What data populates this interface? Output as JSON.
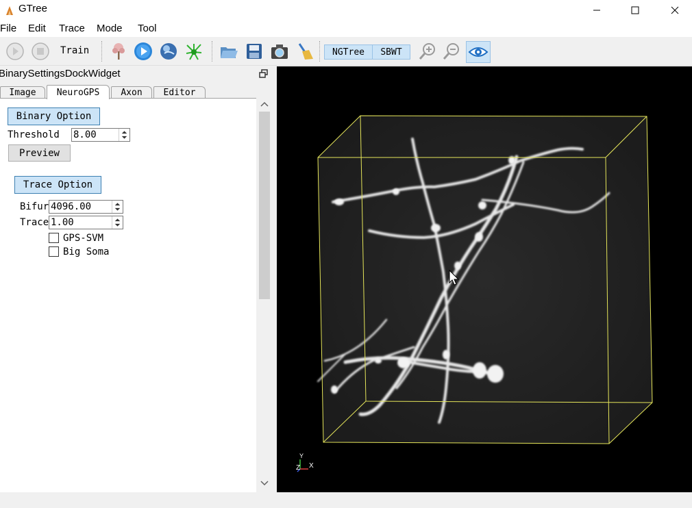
{
  "window": {
    "title": "GTree",
    "controls": [
      "minimize-icon",
      "maximize-icon",
      "close-icon"
    ]
  },
  "menu": {
    "items": [
      "File",
      "Edit",
      "Trace",
      "Mode",
      "Tool"
    ]
  },
  "toolbar": {
    "train_label": "Train",
    "icons": [
      "play-icon",
      "stop-icon",
      "tree-icon",
      "run-icon",
      "globe-icon",
      "neuron-icon",
      "open-folder-icon",
      "save-icon",
      "camera-icon",
      "broom-icon",
      "zoom-in-icon",
      "zoom-out-icon",
      "eye-icon"
    ],
    "segment": [
      "NGTree",
      "SBWT"
    ]
  },
  "dock": {
    "title": "BinarySettingsDockWidget",
    "tabs": [
      "Image",
      "NeuroGPS",
      "Axon",
      "Editor"
    ],
    "active_tab": "NeuroGPS"
  },
  "binary": {
    "button": "Binary Option",
    "threshold_label": "Threshold",
    "threshold_value": "8.00",
    "preview_button": "Preview"
  },
  "trace": {
    "button": "Trace Option",
    "bifur_label": "Bifur",
    "bifur_value": "4096.00",
    "trace_label": "Trace",
    "trace_value": "1.00",
    "gps_svm_label": "GPS-SVM",
    "gps_svm_checked": false,
    "big_soma_label": "Big Soma",
    "big_soma_checked": false
  },
  "view": {
    "axis_y": "Y",
    "axis_z": "Z",
    "axis_x": "X",
    "box_color": "#e6e65a"
  }
}
